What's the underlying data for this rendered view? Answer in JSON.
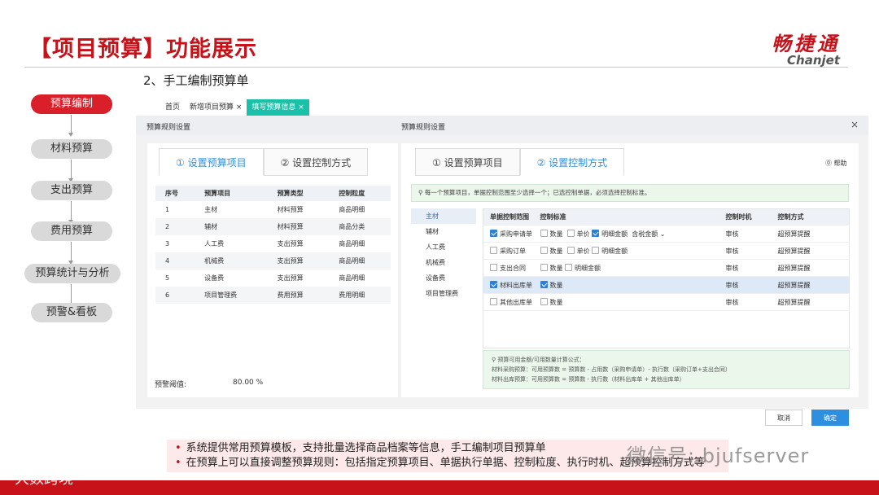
{
  "title": "【项目预算】功能展示",
  "logo": {
    "cn": "畅捷通",
    "en": "Chanjet"
  },
  "subtitle": "2、手工编制预算单",
  "flow": [
    "预算编制",
    "材料预算",
    "支出预算",
    "费用预算",
    "预算统计与分析",
    "预警&看板"
  ],
  "app": {
    "tabs": [
      "首页",
      "新增项目预算 ×",
      "填写预算信息 ×"
    ],
    "header_left": "预算规则设置",
    "header_right": "预算规则设置",
    "close": "×",
    "left_tabs": [
      "① 设置预算项目",
      "② 设置控制方式"
    ],
    "right_tabs": [
      "① 设置预算项目",
      "② 设置控制方式"
    ],
    "help": "⓪ 帮助",
    "left_table": {
      "headers": [
        "序号",
        "预算项目",
        "预算类型",
        "控制粒度"
      ],
      "rows": [
        [
          "1",
          "主材",
          "材料预算",
          "商品明细"
        ],
        [
          "2",
          "辅材",
          "材料预算",
          "商品分类"
        ],
        [
          "3",
          "人工费",
          "支出预算",
          "商品明细"
        ],
        [
          "4",
          "机械费",
          "支出预算",
          "商品明细"
        ],
        [
          "5",
          "设备费",
          "支出预算",
          "商品明细"
        ],
        [
          "6",
          "项目管理费",
          "费用预算",
          "费用明细"
        ]
      ]
    },
    "threshold_label": "预警阈值:",
    "threshold_value": "80.00 %",
    "info": "⚲ 每一个预算项目，单据控制范围至少选择一个；已选控制单据，必须选择控制标准。",
    "right_list": [
      "主材",
      "辅材",
      "人工费",
      "机械费",
      "设备费",
      "项目管理费"
    ],
    "right_table": {
      "headers": [
        "单据控制范围",
        "控制标准",
        "控制时机",
        "控制方式"
      ],
      "rows": [
        {
          "doc": "采购申请单",
          "std": [
            "数量",
            "单价",
            "明细金额",
            "含税金额"
          ],
          "timing": "审核",
          "mode": "超预算提醒"
        },
        {
          "doc": "采购订单",
          "std": [
            "数量",
            "单价",
            "明细金额"
          ],
          "timing": "审核",
          "mode": "超预算提醒"
        },
        {
          "doc": "支出合同",
          "std": [
            "数量",
            "明细金额"
          ],
          "timing": "审核",
          "mode": "超预算提醒"
        },
        {
          "doc": "材料出库单",
          "std": [
            "数量"
          ],
          "timing": "审核",
          "mode": "超预算提醒"
        },
        {
          "doc": "其他出库单",
          "std": [
            "数量"
          ],
          "timing": "审核",
          "mode": "超预算提醒"
        }
      ]
    },
    "formula": {
      "title": "⚲ 预算可用金额/可用数量计算公式：",
      "line1": "材料采购预算：可用预算数 = 预算数 - 占用数（采购申请单）- 执行数（采购订单+支出合同）",
      "line2": "材料出库预算：可用预算数 = 预算数 - 执行数（材料出库单 + 其他出库单）"
    },
    "cancel": "取消",
    "confirm": "确定"
  },
  "notes": [
    "系统提供常用预算模板，支持批量选择商品档案等信息，手工编制项目预算单",
    "在预算上可以直接调整预算规则：包括指定预算项目、单据执行单据、控制粒度、执行时机、超预算控制方式等"
  ],
  "watermark_left": "大数跨境",
  "watermark_right": "微信号: bjufserver"
}
